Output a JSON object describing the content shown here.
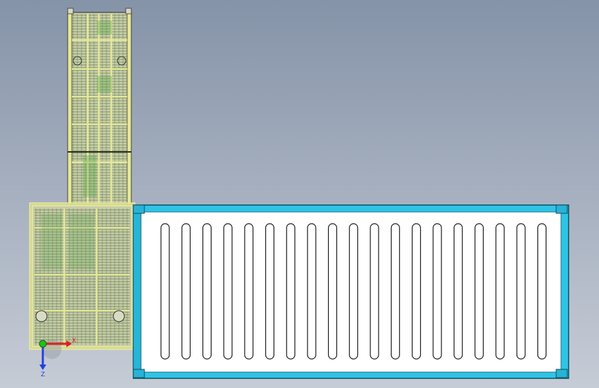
{
  "viewport": {
    "background_top": "#8593a8",
    "background_bottom": "#c6ccd6"
  },
  "conveyor": {
    "frame_color": "#e6e89a",
    "mesh_color": "#3f5a3a",
    "accent_color": "#5aa84a",
    "mesh_columns": 3
  },
  "base_frame": {
    "frame_color": "#e6e89a",
    "mesh_color": "#3f5a3a",
    "mesh_columns": 3
  },
  "container": {
    "frame_color": "#2ec4e6",
    "corner_color": "#28b3d6",
    "panel_fill": "#ffffff",
    "slot_count": 19
  },
  "triad": {
    "x_label": "X",
    "z_label": "Z",
    "x_color": "#e02020",
    "z_color": "#2040e0",
    "origin_color": "#20c020"
  }
}
